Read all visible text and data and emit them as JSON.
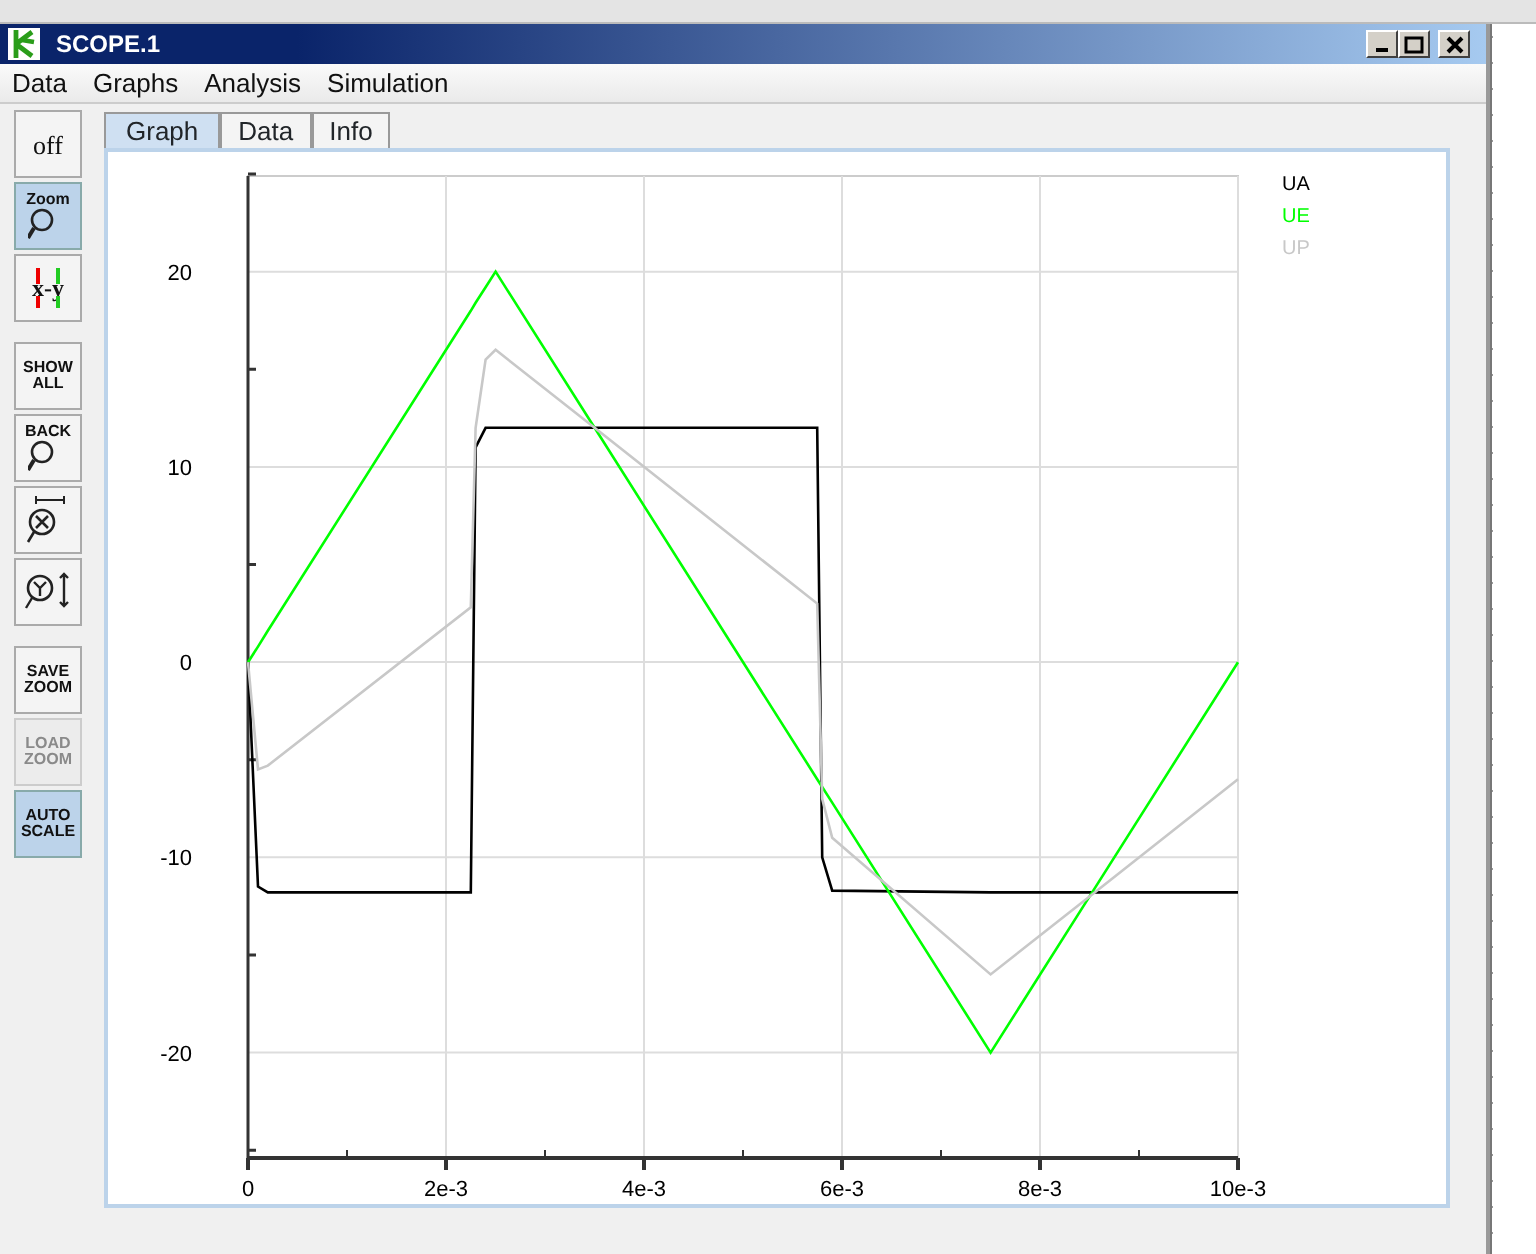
{
  "window": {
    "title": "SCOPE.1"
  },
  "menu": [
    "Data",
    "Graphs",
    "Analysis",
    "Simulation"
  ],
  "tools": [
    {
      "label": "off",
      "kind": "text",
      "selected": false,
      "disabled": false
    },
    {
      "label": "Zoom",
      "kind": "zoom",
      "selected": true,
      "disabled": false
    },
    {
      "label": "x-y",
      "kind": "xy",
      "selected": false,
      "disabled": false
    },
    {
      "label": "SHOW ALL",
      "kind": "text",
      "selected": false,
      "disabled": false
    },
    {
      "label": "BACK",
      "kind": "zoom",
      "selected": false,
      "disabled": false
    },
    {
      "kind": "zoomx",
      "selected": false,
      "disabled": false
    },
    {
      "kind": "zoomy",
      "selected": false,
      "disabled": false
    },
    {
      "label": "SAVE ZOOM",
      "kind": "text",
      "selected": false,
      "disabled": false
    },
    {
      "label": "LOAD ZOOM",
      "kind": "text",
      "selected": false,
      "disabled": true
    },
    {
      "label": "AUTO SCALE",
      "kind": "text",
      "selected": true,
      "disabled": false
    }
  ],
  "tabs": [
    {
      "label": "Graph",
      "selected": true
    },
    {
      "label": "Data",
      "selected": false
    },
    {
      "label": "Info",
      "selected": false
    }
  ],
  "chart_data": {
    "type": "line",
    "x": [
      0,
      0.0001,
      0.0002,
      0.00225,
      0.0023,
      0.0024,
      0.0025,
      0.0035,
      0.00575,
      0.0058,
      0.0059,
      0.0075,
      0.0085,
      0.01
    ],
    "series": [
      {
        "name": "UA",
        "color": "#000000",
        "values": [
          0,
          -11.5,
          -11.8,
          -11.8,
          11,
          12,
          12,
          12,
          12,
          -10,
          -11.7,
          -11.8,
          -11.8,
          -11.8
        ]
      },
      {
        "name": "UE",
        "color": "#00ff00",
        "values": [
          0,
          0.8,
          1.6,
          18,
          18.4,
          19.2,
          20,
          12,
          -6,
          -6.4,
          -7.2,
          -20,
          -12,
          0
        ]
      },
      {
        "name": "UP",
        "color": "#c8c8c8",
        "values": [
          0,
          -5.5,
          -5.3,
          2.8,
          12,
          15.5,
          16,
          12,
          3,
          -7,
          -9,
          -16,
          -12,
          -6
        ]
      }
    ],
    "xlim": [
      0,
      0.01
    ],
    "ylim": [
      -25.4,
      24.9
    ],
    "xticks": [
      {
        "value": 0,
        "label": "0"
      },
      {
        "value": 0.002,
        "label": "2e-3"
      },
      {
        "value": 0.004,
        "label": "4e-3"
      },
      {
        "value": 0.006,
        "label": "6e-3"
      },
      {
        "value": 0.008,
        "label": "8e-3"
      },
      {
        "value": 0.01,
        "label": "10e-3"
      }
    ],
    "yticks": [
      -20,
      -10,
      0,
      10,
      20
    ],
    "grid": true
  }
}
